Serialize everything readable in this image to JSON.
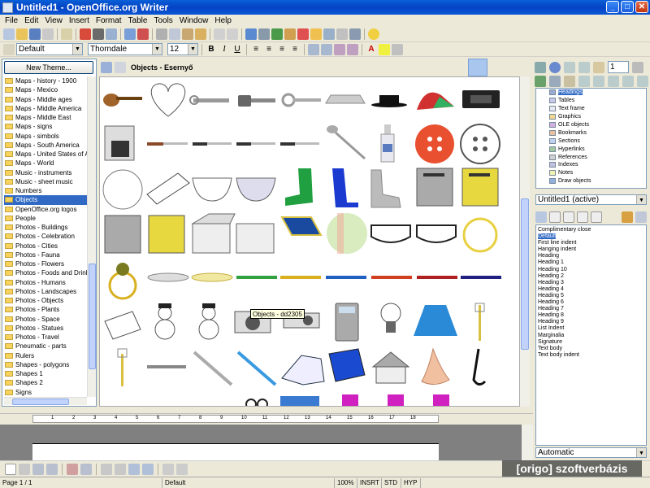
{
  "window": {
    "title": "Untitled1 - OpenOffice.org Writer"
  },
  "menu": [
    "File",
    "Edit",
    "View",
    "Insert",
    "Format",
    "Table",
    "Tools",
    "Window",
    "Help"
  ],
  "format": {
    "style": "Default",
    "font": "Thorndale",
    "size": "12"
  },
  "gallery_pane": {
    "new_theme_label": "New Theme...",
    "themes": [
      "Maps - history - 1900",
      "Maps - Mexico",
      "Maps - Middle ages",
      "Maps - Middle America",
      "Maps - Middle East",
      "Maps - signs",
      "Maps - simbols",
      "Maps - South America",
      "Maps - United States of Amer",
      "Maps - World",
      "Music - instruments",
      "Music - sheet music",
      "Numbers",
      "Objects",
      "OpenOffice.org logos",
      "People",
      "Photos - Buildings",
      "Photos - Celebration",
      "Photos - Cities",
      "Photos - Fauna",
      "Photos - Flowers",
      "Photos - Foods and Drinks",
      "Photos - Humans",
      "Photos - Landscapes",
      "Photos - Objects",
      "Photos - Plants",
      "Photos - Space",
      "Photos - Statues",
      "Photos - Travel",
      "Pneumatic - parts",
      "Rulers",
      "Shapes - polygons",
      "Shapes 1",
      "Shapes 2",
      "Signs"
    ],
    "selected_theme": "Objects",
    "gallery_title": "Objects - Esernyő",
    "tooltip": "Objects - dd2305"
  },
  "navigator": {
    "items": [
      "Headings",
      "Tables",
      "Text frame",
      "Graphics",
      "OLE objects",
      "Bookmarks",
      "Sections",
      "Hyperlinks",
      "References",
      "Indexes",
      "Notes",
      "Draw objects"
    ],
    "selected": "Headings",
    "active_doc": "Untitled1 (active)",
    "counter": "1"
  },
  "styles": {
    "items": [
      "Complimentary close",
      "Default",
      "First line indent",
      "Hanging indent",
      "Heading",
      "Heading 1",
      "Heading 10",
      "Heading 2",
      "Heading 3",
      "Heading 4",
      "Heading 5",
      "Heading 6",
      "Heading 7",
      "Heading 8",
      "Heading 9",
      "List Indent",
      "Marginalia",
      "Signature",
      "Text body",
      "Text body indent"
    ],
    "selected": "Default",
    "filter": "Automatic"
  },
  "ruler_numbers": [
    "1",
    "2",
    "3",
    "4",
    "5",
    "6",
    "7",
    "8",
    "9",
    "10",
    "11",
    "12",
    "13",
    "14",
    "15",
    "16",
    "17",
    "18"
  ],
  "status": {
    "page": "Page 1 / 1",
    "style": "Default",
    "zoom": "100%",
    "insrt": "INSRT",
    "std": "STD",
    "hyp": "HYP"
  },
  "watermark": "[origo] szoftverbázis",
  "colors": {
    "title_bar": "#0a5fd8",
    "selection": "#316ac5",
    "folder": "#f5d35c"
  }
}
